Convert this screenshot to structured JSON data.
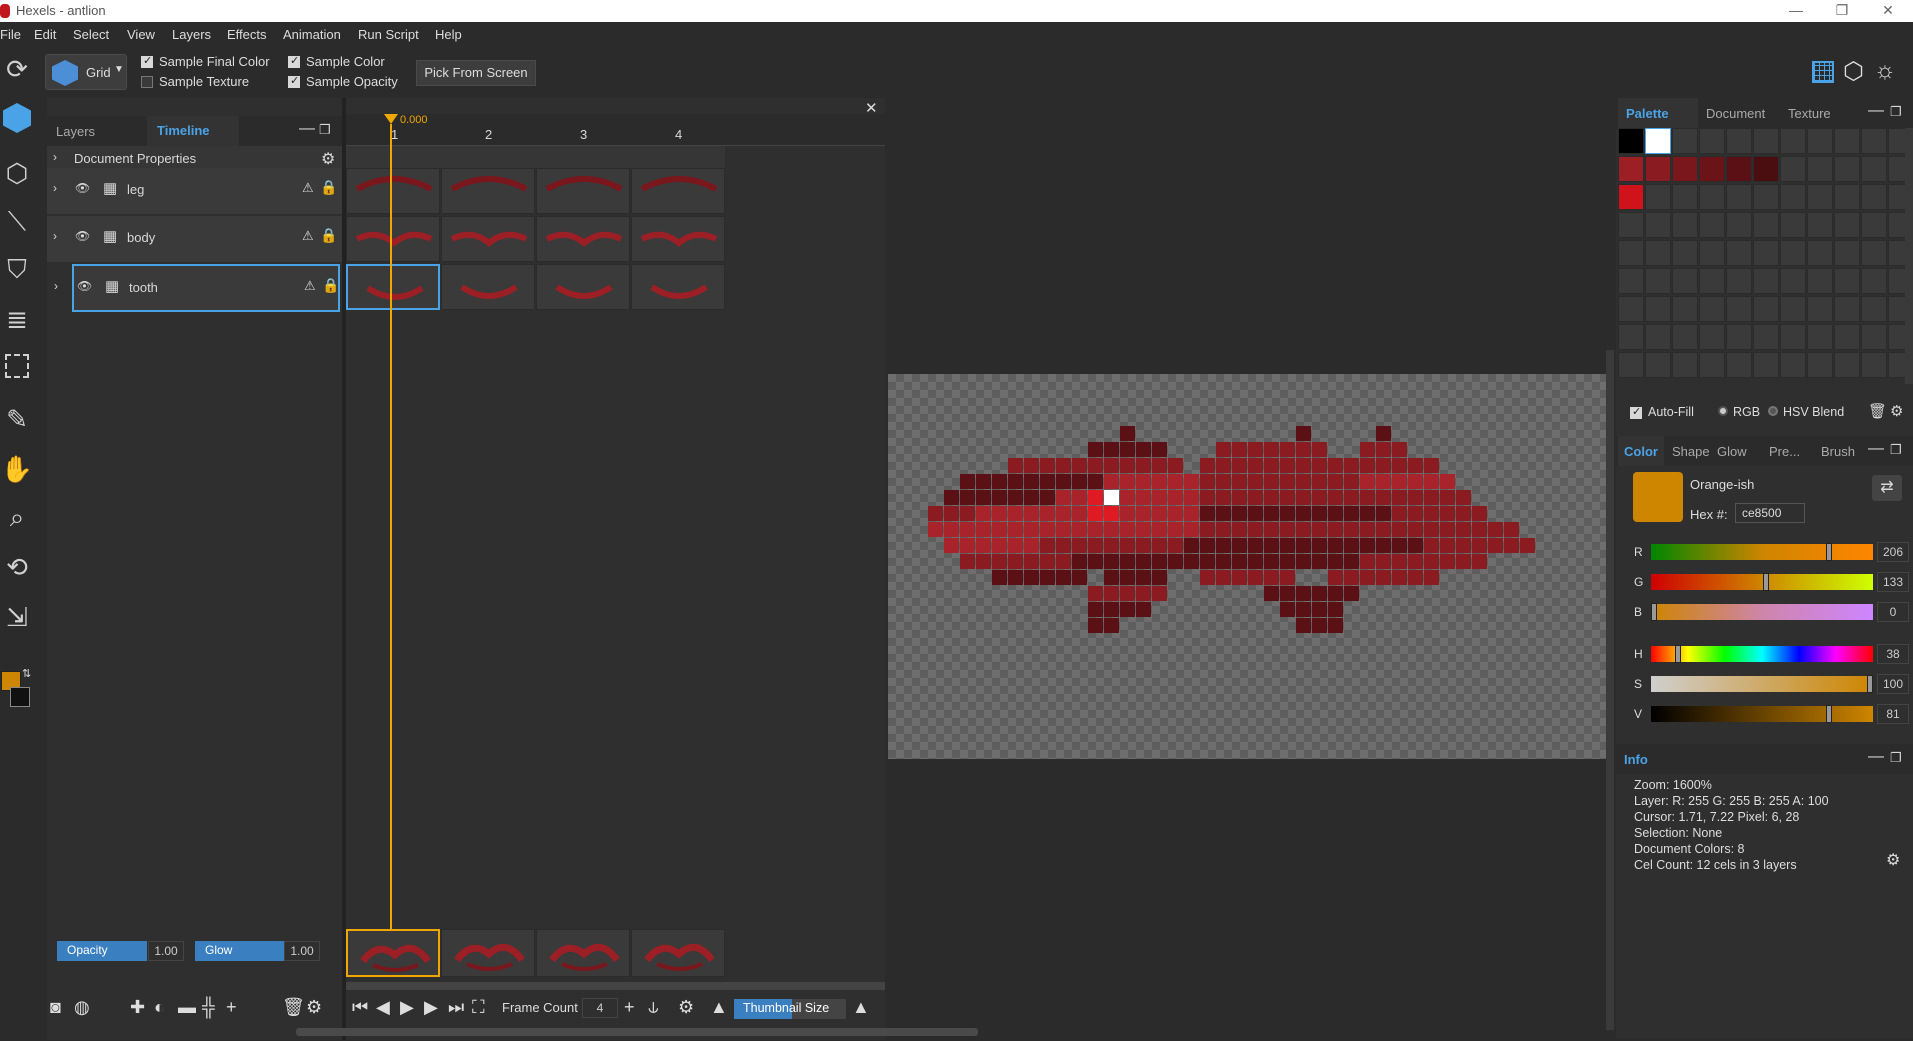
{
  "app": {
    "title": "Hexels - antlion"
  },
  "menu": [
    "File",
    "Edit",
    "Select",
    "View",
    "Layers",
    "Effects",
    "Animation",
    "Run Script",
    "Help"
  ],
  "options": {
    "grid_label": "Grid",
    "sample_final_color": "Sample Final Color",
    "sample_texture": "Sample Texture",
    "sample_color": "Sample Color",
    "sample_opacity": "Sample Opacity",
    "pick_from_screen": "Pick From Screen"
  },
  "layers_panel": {
    "tabs": [
      "Layers",
      "Timeline"
    ],
    "doc_props": "Document Properties",
    "layers": [
      {
        "name": "leg"
      },
      {
        "name": "body"
      },
      {
        "name": "tooth"
      }
    ],
    "opacity_label": "Opacity",
    "opacity_value": "1.00",
    "glow_label": "Glow",
    "glow_value": "1.00"
  },
  "timeline": {
    "time": "0.000",
    "frames": [
      "1",
      "2",
      "3",
      "4"
    ],
    "frame_count_label": "Frame Count",
    "frame_count": "4",
    "thumb_label": "Thumbnail Size"
  },
  "palette": {
    "tabs": [
      "Palette",
      "Document",
      "Texture"
    ],
    "colors": [
      "#000000",
      "#ffffff",
      "#9b1f25",
      "#8a1b20",
      "#7a171c",
      "#6a1418",
      "#5a1014",
      "#4a0d10",
      "#d0121a"
    ],
    "autofill": "Auto-Fill",
    "rgb": "RGB",
    "hsv": "HSV Blend"
  },
  "color": {
    "tabs": [
      "Color",
      "Shape",
      "Glow",
      "Pre...",
      "Brush"
    ],
    "name": "Orange-ish",
    "hex_label": "Hex #:",
    "hex": "ce8500",
    "swatch": "#ce8500",
    "channels": [
      {
        "label": "R",
        "value": "206",
        "frac": 0.81
      },
      {
        "label": "G",
        "value": "133",
        "frac": 0.52
      },
      {
        "label": "B",
        "value": "0",
        "frac": 0.0
      },
      {
        "label": "H",
        "value": "38",
        "frac": 0.11
      },
      {
        "label": "S",
        "value": "100",
        "frac": 1.0
      },
      {
        "label": "V",
        "value": "81",
        "frac": 0.81
      }
    ]
  },
  "info": {
    "title": "Info",
    "lines": [
      "Zoom:  1600%",
      "Layer:  R: 255  G: 255  B: 255  A: 100",
      "Cursor: 1.71, 7.22  Pixel: 6, 28",
      "Selection:  None",
      "Document Colors:  8",
      "Cel Count:  12 cels in 3 layers"
    ]
  },
  "icons": [
    "rotate-icon",
    "hex-fill-icon",
    "hex-outline-icon",
    "line-icon",
    "bucket-icon",
    "layers-icon",
    "select-icon",
    "dropper-icon",
    "hand-icon",
    "zoom-icon",
    "transform-icon",
    "fill-tool-icon"
  ]
}
